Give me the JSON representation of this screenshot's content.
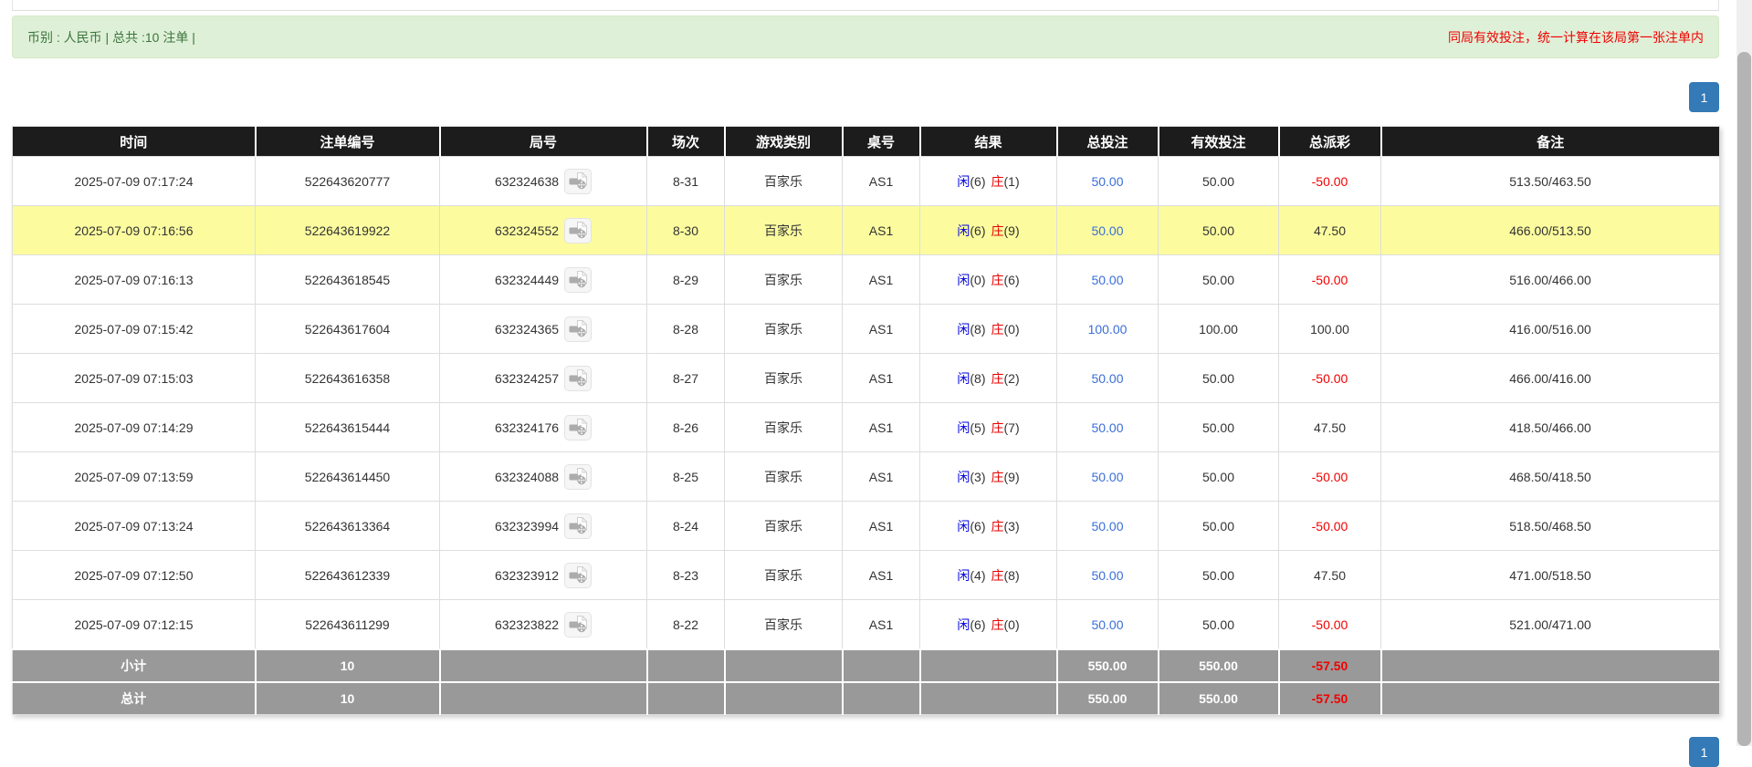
{
  "banner": {
    "left_text": "币别 : 人民币 | 总共 :10 注单 |",
    "right_note": "同局有效投注，统一计算在该局第一张注单内"
  },
  "pagination": {
    "current_page": "1"
  },
  "table": {
    "headers": [
      "时间",
      "注单编号",
      "局号",
      "场次",
      "游戏类别",
      "桌号",
      "结果",
      "总投注",
      "有效投注",
      "总派彩",
      "备注"
    ],
    "result_labels": {
      "player": "闲",
      "banker": "庄"
    },
    "rows": [
      {
        "time": "2025-07-09 07:17:24",
        "bet_id": "522643620777",
        "round_id": "632324638",
        "session": "8-31",
        "game_type": "百家乐",
        "table_no": "AS1",
        "player_points": "6",
        "banker_points": "1",
        "total_bet": "50.00",
        "valid_bet": "50.00",
        "total_payout": "-50.00",
        "note": "513.50/463.50",
        "highlighted": false
      },
      {
        "time": "2025-07-09 07:16:56",
        "bet_id": "522643619922",
        "round_id": "632324552",
        "session": "8-30",
        "game_type": "百家乐",
        "table_no": "AS1",
        "player_points": "6",
        "banker_points": "9",
        "total_bet": "50.00",
        "valid_bet": "50.00",
        "total_payout": "47.50",
        "note": "466.00/513.50",
        "highlighted": true
      },
      {
        "time": "2025-07-09 07:16:13",
        "bet_id": "522643618545",
        "round_id": "632324449",
        "session": "8-29",
        "game_type": "百家乐",
        "table_no": "AS1",
        "player_points": "0",
        "banker_points": "6",
        "total_bet": "50.00",
        "valid_bet": "50.00",
        "total_payout": "-50.00",
        "note": "516.00/466.00",
        "highlighted": false
      },
      {
        "time": "2025-07-09 07:15:42",
        "bet_id": "522643617604",
        "round_id": "632324365",
        "session": "8-28",
        "game_type": "百家乐",
        "table_no": "AS1",
        "player_points": "8",
        "banker_points": "0",
        "total_bet": "100.00",
        "valid_bet": "100.00",
        "total_payout": "100.00",
        "note": "416.00/516.00",
        "highlighted": false
      },
      {
        "time": "2025-07-09 07:15:03",
        "bet_id": "522643616358",
        "round_id": "632324257",
        "session": "8-27",
        "game_type": "百家乐",
        "table_no": "AS1",
        "player_points": "8",
        "banker_points": "2",
        "total_bet": "50.00",
        "valid_bet": "50.00",
        "total_payout": "-50.00",
        "note": "466.00/416.00",
        "highlighted": false
      },
      {
        "time": "2025-07-09 07:14:29",
        "bet_id": "522643615444",
        "round_id": "632324176",
        "session": "8-26",
        "game_type": "百家乐",
        "table_no": "AS1",
        "player_points": "5",
        "banker_points": "7",
        "total_bet": "50.00",
        "valid_bet": "50.00",
        "total_payout": "47.50",
        "note": "418.50/466.00",
        "highlighted": false
      },
      {
        "time": "2025-07-09 07:13:59",
        "bet_id": "522643614450",
        "round_id": "632324088",
        "session": "8-25",
        "game_type": "百家乐",
        "table_no": "AS1",
        "player_points": "3",
        "banker_points": "9",
        "total_bet": "50.00",
        "valid_bet": "50.00",
        "total_payout": "-50.00",
        "note": "468.50/418.50",
        "highlighted": false
      },
      {
        "time": "2025-07-09 07:13:24",
        "bet_id": "522643613364",
        "round_id": "632323994",
        "session": "8-24",
        "game_type": "百家乐",
        "table_no": "AS1",
        "player_points": "6",
        "banker_points": "3",
        "total_bet": "50.00",
        "valid_bet": "50.00",
        "total_payout": "-50.00",
        "note": "518.50/468.50",
        "highlighted": false
      },
      {
        "time": "2025-07-09 07:12:50",
        "bet_id": "522643612339",
        "round_id": "632323912",
        "session": "8-23",
        "game_type": "百家乐",
        "table_no": "AS1",
        "player_points": "4",
        "banker_points": "8",
        "total_bet": "50.00",
        "valid_bet": "50.00",
        "total_payout": "47.50",
        "note": "471.00/518.50",
        "highlighted": false
      },
      {
        "time": "2025-07-09 07:12:15",
        "bet_id": "522643611299",
        "round_id": "632323822",
        "session": "8-22",
        "game_type": "百家乐",
        "table_no": "AS1",
        "player_points": "6",
        "banker_points": "0",
        "total_bet": "50.00",
        "valid_bet": "50.00",
        "total_payout": "-50.00",
        "note": "521.00/471.00",
        "highlighted": false
      }
    ],
    "summary": {
      "subtotal": {
        "label": "小计",
        "count": "10",
        "total_bet": "550.00",
        "valid_bet": "550.00",
        "total_payout": "-57.50"
      },
      "total": {
        "label": "总计",
        "count": "10",
        "total_bet": "550.00",
        "valid_bet": "550.00",
        "total_payout": "-57.50"
      }
    }
  },
  "colors": {
    "header_bg": "#1c1c1c",
    "highlight_row": "#fcfc9f",
    "bet_link_blue": "#3a6ed8",
    "player_blue": "#0202dd",
    "banker_red": "#e60000",
    "negative_red": "#f20000",
    "summary_gray": "#999999",
    "banner_bg": "#dff0d8",
    "banner_text_green": "#3c763d",
    "pagination_blue": "#337ab7"
  }
}
